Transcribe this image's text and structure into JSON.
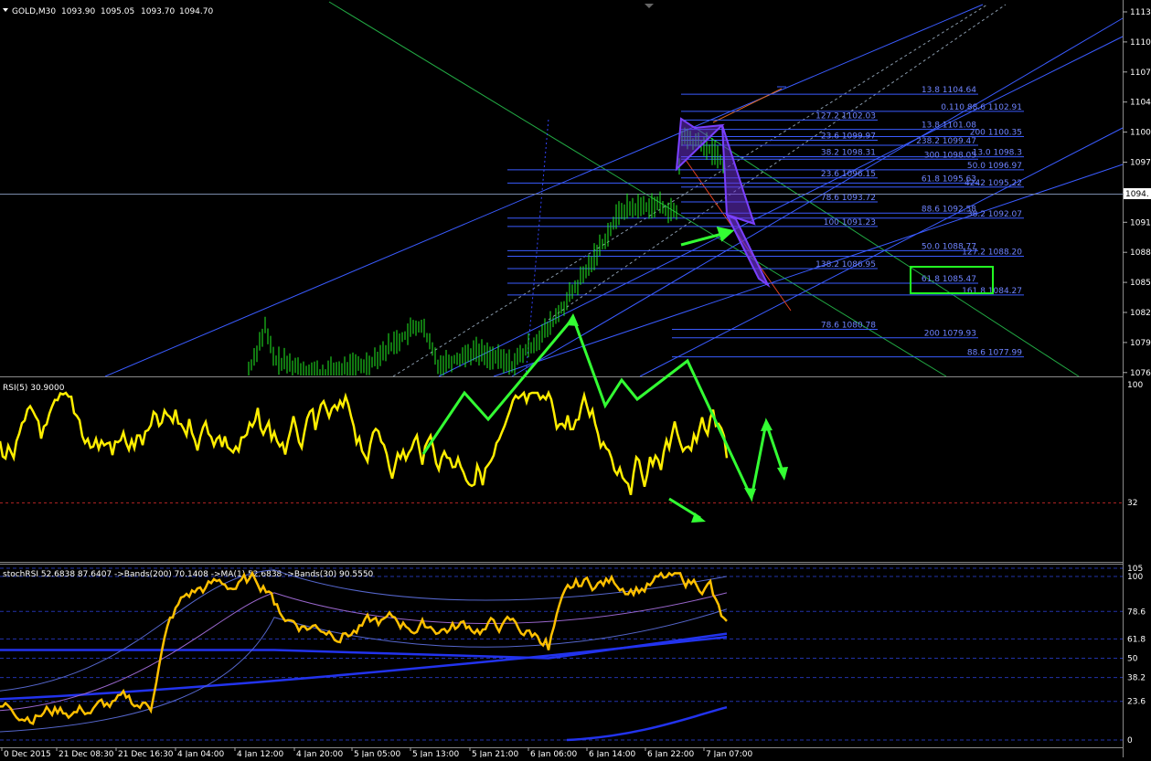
{
  "chart_data": [
    {
      "type": "candlestick",
      "symbol": "GOLD,M30",
      "ohlc_header": [
        "1093.90",
        "1095.05",
        "1093.70",
        "1094.70"
      ],
      "last_price_label": "1094.",
      "y_ticks": [
        "1113.",
        "1110.",
        "1107.",
        "1104.",
        "1100.",
        "1097.",
        "1094.",
        "1091.",
        "1088.",
        "1085.",
        "1082.",
        "1079.",
        "1076."
      ],
      "fib_levels": [
        "13.8 1104.64",
        "0.110 88.6 1102.91",
        "127.2 1102.03",
        "13.8 1101.08",
        "200 1100.35",
        "23.6 1099.97",
        "238.2 1099.47",
        "13.0 1098.3",
        "38.2 1098.31",
        "300 1098.05",
        "50.0 1096.97",
        "23.6 1096.15",
        "61.8 1095.63",
        "4242 1095.22",
        "78.6 1093.72",
        "88.6 1092.58",
        "38.2 1092.07",
        "100 1091.23",
        "50.0 1088.77",
        "127.2 1088.20",
        "138.2 1086.95",
        "61.8 1085.47",
        "161.8 1084.27",
        "78.6 1080.78",
        "200 1079.93",
        "88.6 1077.99"
      ],
      "highlighted_level": "61.8 1085.47"
    },
    {
      "type": "line",
      "label": "RSI(5) 30.9000",
      "y_ticks": [
        "100",
        "32"
      ],
      "ylim": [
        0,
        100
      ]
    },
    {
      "type": "line",
      "label": "stochRSI 52.6838 87.6407  ->Bands(200) 70.1408  ->MA(1) 52.6838  ->Bands(30) 90.5550",
      "y_ticks": [
        "105",
        "100",
        "78.6",
        "61.8",
        "50",
        "38.2",
        "23.6",
        "0"
      ],
      "ylim": [
        0,
        105
      ]
    }
  ],
  "x_axis_labels": [
    "0 Dec 2015",
    "21 Dec 08:30",
    "21 Dec 16:30",
    "4 Jan 04:00",
    "4 Jan 12:00",
    "4 Jan 20:00",
    "5 Jan 05:00",
    "5 Jan 13:00",
    "5 Jan 21:00",
    "6 Jan 06:00",
    "6 Jan 14:00",
    "6 Jan 22:00",
    "7 Jan 07:00"
  ],
  "colors": {
    "background": "#000000",
    "candles": "#22ee22",
    "rsi_line": "#ffee00",
    "stoch_line": "#ffc000",
    "bands": "#3344ff",
    "annotation_arrows": "#33ff33",
    "fib_lines": "#3a5bff",
    "highlight_box": "#22ff22"
  }
}
